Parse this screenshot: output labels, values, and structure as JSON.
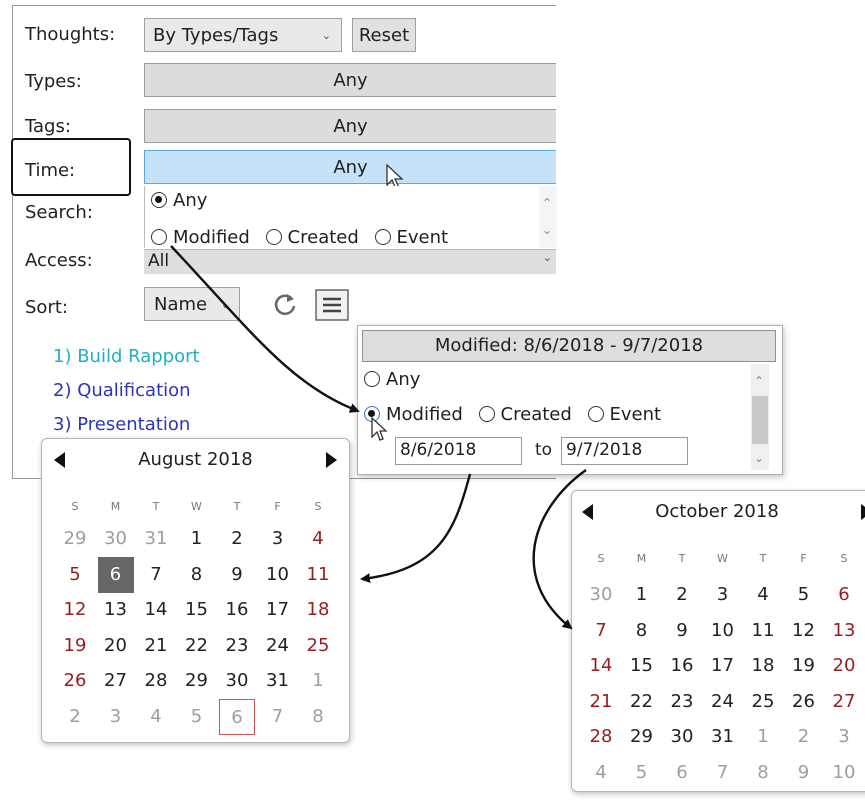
{
  "filter_panel": {
    "thoughts_label": "Thoughts:",
    "thoughts_value": "By Types/Tags",
    "reset_label": "Reset",
    "types_label": "Types:",
    "types_value": "Any",
    "tags_label": "Tags:",
    "tags_value": "Any",
    "time_label": "Time:",
    "time_value": "Any",
    "search_label": "Search:",
    "time_options": {
      "any": "Any",
      "modified": "Modified",
      "created": "Created",
      "event": "Event"
    },
    "access_label": "Access:",
    "access_value": "All",
    "sort_label": "Sort:",
    "sort_value": "Name"
  },
  "thought_list": [
    {
      "text": "1) Build Rapport",
      "color": "#1bb3c4"
    },
    {
      "text": "2) Qualification",
      "color": "#2d35b8"
    },
    {
      "text": "3) Presentation",
      "color": "#2d35b8"
    }
  ],
  "modified_popup": {
    "header": "Modified: 8/6/2018 - 9/7/2018",
    "options": {
      "any": "Any",
      "modified": "Modified",
      "created": "Created",
      "event": "Event"
    },
    "from_date": "8/6/2018",
    "to_label": "to",
    "to_date": "9/7/2018"
  },
  "calendar_aug": {
    "title": "August 2018",
    "dow": [
      "S",
      "M",
      "T",
      "W",
      "T",
      "F",
      "S"
    ],
    "weeks": [
      [
        "29",
        "30",
        "31",
        "1",
        "2",
        "3",
        "4"
      ],
      [
        "5",
        "6",
        "7",
        "8",
        "9",
        "10",
        "11"
      ],
      [
        "12",
        "13",
        "14",
        "15",
        "16",
        "17",
        "18"
      ],
      [
        "19",
        "20",
        "21",
        "22",
        "23",
        "24",
        "25"
      ],
      [
        "26",
        "27",
        "28",
        "29",
        "30",
        "31",
        "1"
      ],
      [
        "2",
        "3",
        "4",
        "5",
        "6",
        "7",
        "8"
      ]
    ],
    "selected_day": "6"
  },
  "calendar_oct": {
    "title": "October 2018",
    "dow": [
      "S",
      "M",
      "T",
      "W",
      "T",
      "F",
      "S"
    ],
    "weeks": [
      [
        "30",
        "1",
        "2",
        "3",
        "4",
        "5",
        "6"
      ],
      [
        "7",
        "8",
        "9",
        "10",
        "11",
        "12",
        "13"
      ],
      [
        "14",
        "15",
        "16",
        "17",
        "18",
        "19",
        "20"
      ],
      [
        "21",
        "22",
        "23",
        "24",
        "25",
        "26",
        "27"
      ],
      [
        "28",
        "29",
        "30",
        "31",
        "1",
        "2",
        "3"
      ],
      [
        "4",
        "5",
        "6",
        "7",
        "8",
        "9",
        "10"
      ]
    ]
  },
  "icons": {
    "refresh": "refresh-icon",
    "menu": "menu-icon",
    "chevron": "chevron-down-icon",
    "prev": "prev-month-icon",
    "next": "next-month-icon",
    "cursor": "mouse-cursor-icon"
  },
  "colors": {
    "selected_bar": "#c6e2f8",
    "weekend_red": "#9a1c1c",
    "callout_border": "#111111"
  }
}
